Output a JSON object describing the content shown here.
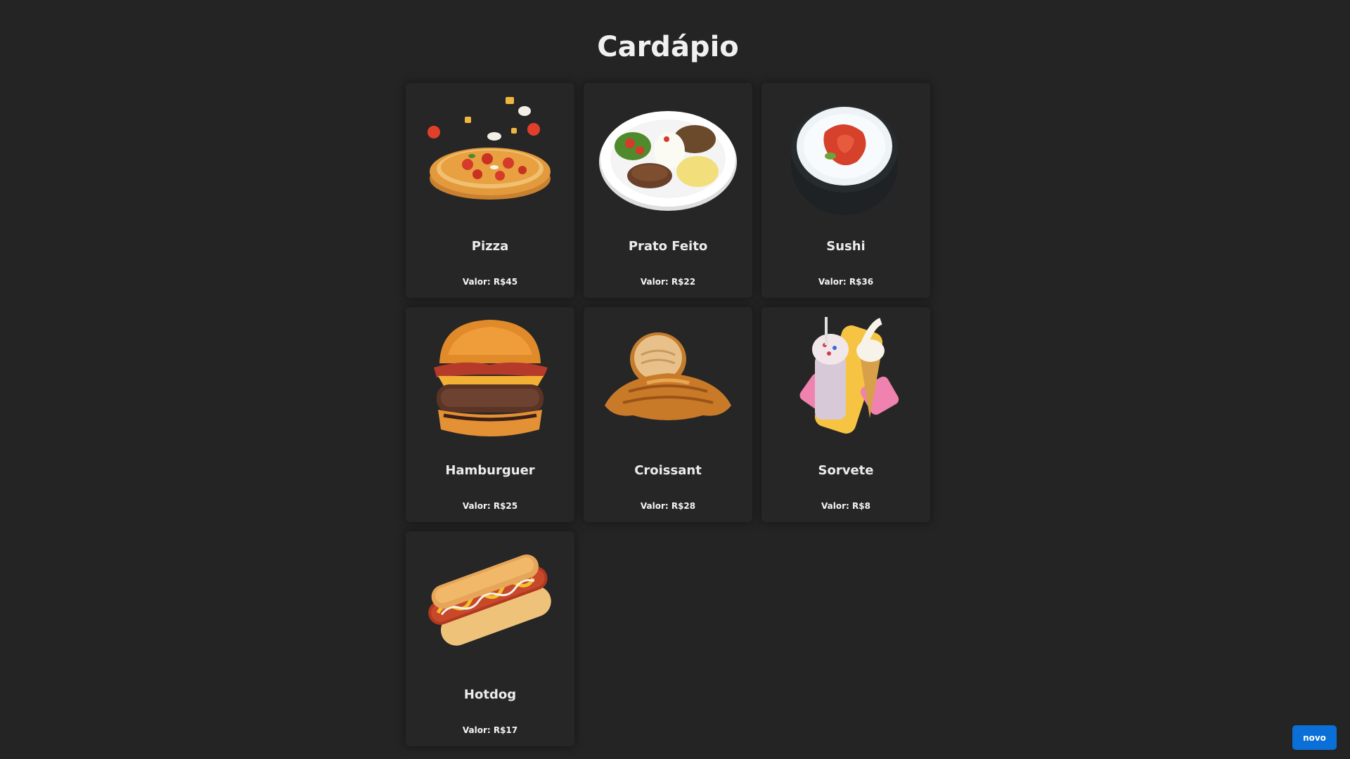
{
  "page": {
    "title": "Cardápio"
  },
  "menu": {
    "items": [
      {
        "name": "Pizza",
        "price": "Valor: R$45",
        "icon": "pizza-image"
      },
      {
        "name": "Prato Feito",
        "price": "Valor: R$22",
        "icon": "prato-feito-image"
      },
      {
        "name": "Sushi",
        "price": "Valor: R$36",
        "icon": "sushi-image"
      },
      {
        "name": "Hamburguer",
        "price": "Valor: R$25",
        "icon": "hamburguer-image"
      },
      {
        "name": "Croissant",
        "price": "Valor: R$28",
        "icon": "croissant-image"
      },
      {
        "name": "Sorvete",
        "price": "Valor: R$8",
        "icon": "sorvete-image"
      },
      {
        "name": "Hotdog",
        "price": "Valor: R$17",
        "icon": "hotdog-image"
      }
    ]
  },
  "actions": {
    "new_label": "novo"
  },
  "colors": {
    "background": "#242424",
    "card": "#262626",
    "accent": "#0a6fd6"
  }
}
